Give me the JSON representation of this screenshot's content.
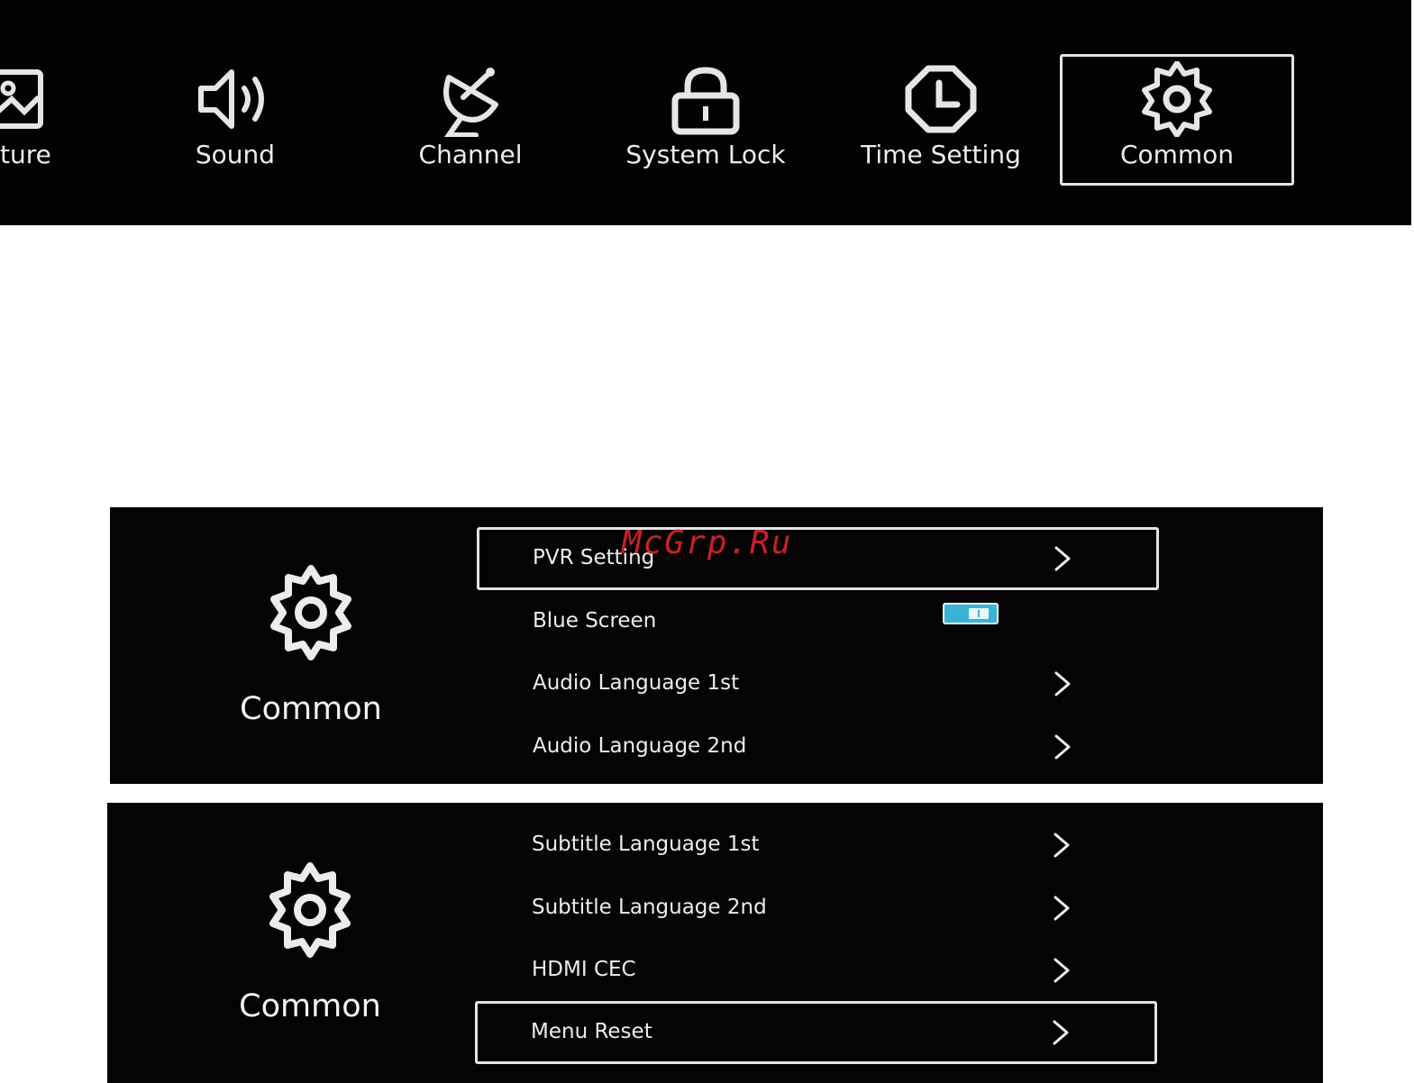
{
  "top_menu": {
    "tabs": [
      {
        "label": "ture",
        "icon": "picture-icon",
        "selected": false
      },
      {
        "label": "Sound",
        "icon": "speaker-icon",
        "selected": false
      },
      {
        "label": "Channel",
        "icon": "satellite-dish-icon",
        "selected": false
      },
      {
        "label": "System Lock",
        "icon": "padlock-icon",
        "selected": false
      },
      {
        "label": "Time Setting",
        "icon": "clock-icon",
        "selected": false
      },
      {
        "label": "Common",
        "icon": "gear-icon",
        "selected": true
      }
    ]
  },
  "panel_1": {
    "title": "Common",
    "icon": "gear-icon",
    "items": [
      {
        "label": "PVR Setting",
        "control": "chevron",
        "focused": true
      },
      {
        "label": "Blue Screen",
        "control": "toggle",
        "state": "on",
        "focused": false
      },
      {
        "label": "Audio Language 1st",
        "control": "chevron",
        "focused": false
      },
      {
        "label": "Audio Language 2nd",
        "control": "chevron",
        "focused": false
      }
    ]
  },
  "panel_2": {
    "title": "Common",
    "icon": "gear-icon",
    "items": [
      {
        "label": "Subtitle Language 1st",
        "control": "chevron",
        "focused": false
      },
      {
        "label": "Subtitle Language 2nd",
        "control": "chevron",
        "focused": false
      },
      {
        "label": "HDMI CEC",
        "control": "chevron",
        "focused": false
      },
      {
        "label": "Menu Reset",
        "control": "chevron",
        "focused": true
      }
    ]
  },
  "watermark": "McGrp.Ru",
  "colors": {
    "panel_bg": "#050303",
    "page_bg": "#ffffff",
    "text": "#ededed",
    "focus_border": "#e4e4e4",
    "toggle_on": "#39b4d6",
    "watermark": "#c8202a"
  }
}
